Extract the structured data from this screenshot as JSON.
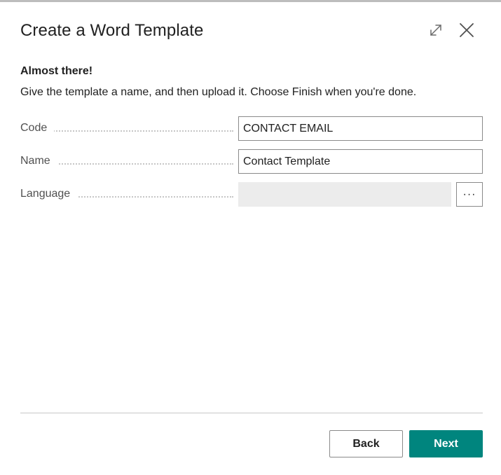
{
  "dialog": {
    "title": "Create a Word Template",
    "subtitle": "Almost there!",
    "instructions": "Give the template a name, and then upload it. Choose Finish when you're done.",
    "expand_icon": "expand-icon",
    "close_icon": "close-icon"
  },
  "fields": {
    "code": {
      "label": "Code",
      "value": "CONTACT EMAIL"
    },
    "name": {
      "label": "Name",
      "value": "Contact Template"
    },
    "language": {
      "label": "Language",
      "value": "",
      "lookup_label": "···"
    }
  },
  "buttons": {
    "back_label": "Back",
    "next_label": "Next"
  },
  "colors": {
    "accent": "#00857e",
    "disabled_field": "#ececec"
  }
}
